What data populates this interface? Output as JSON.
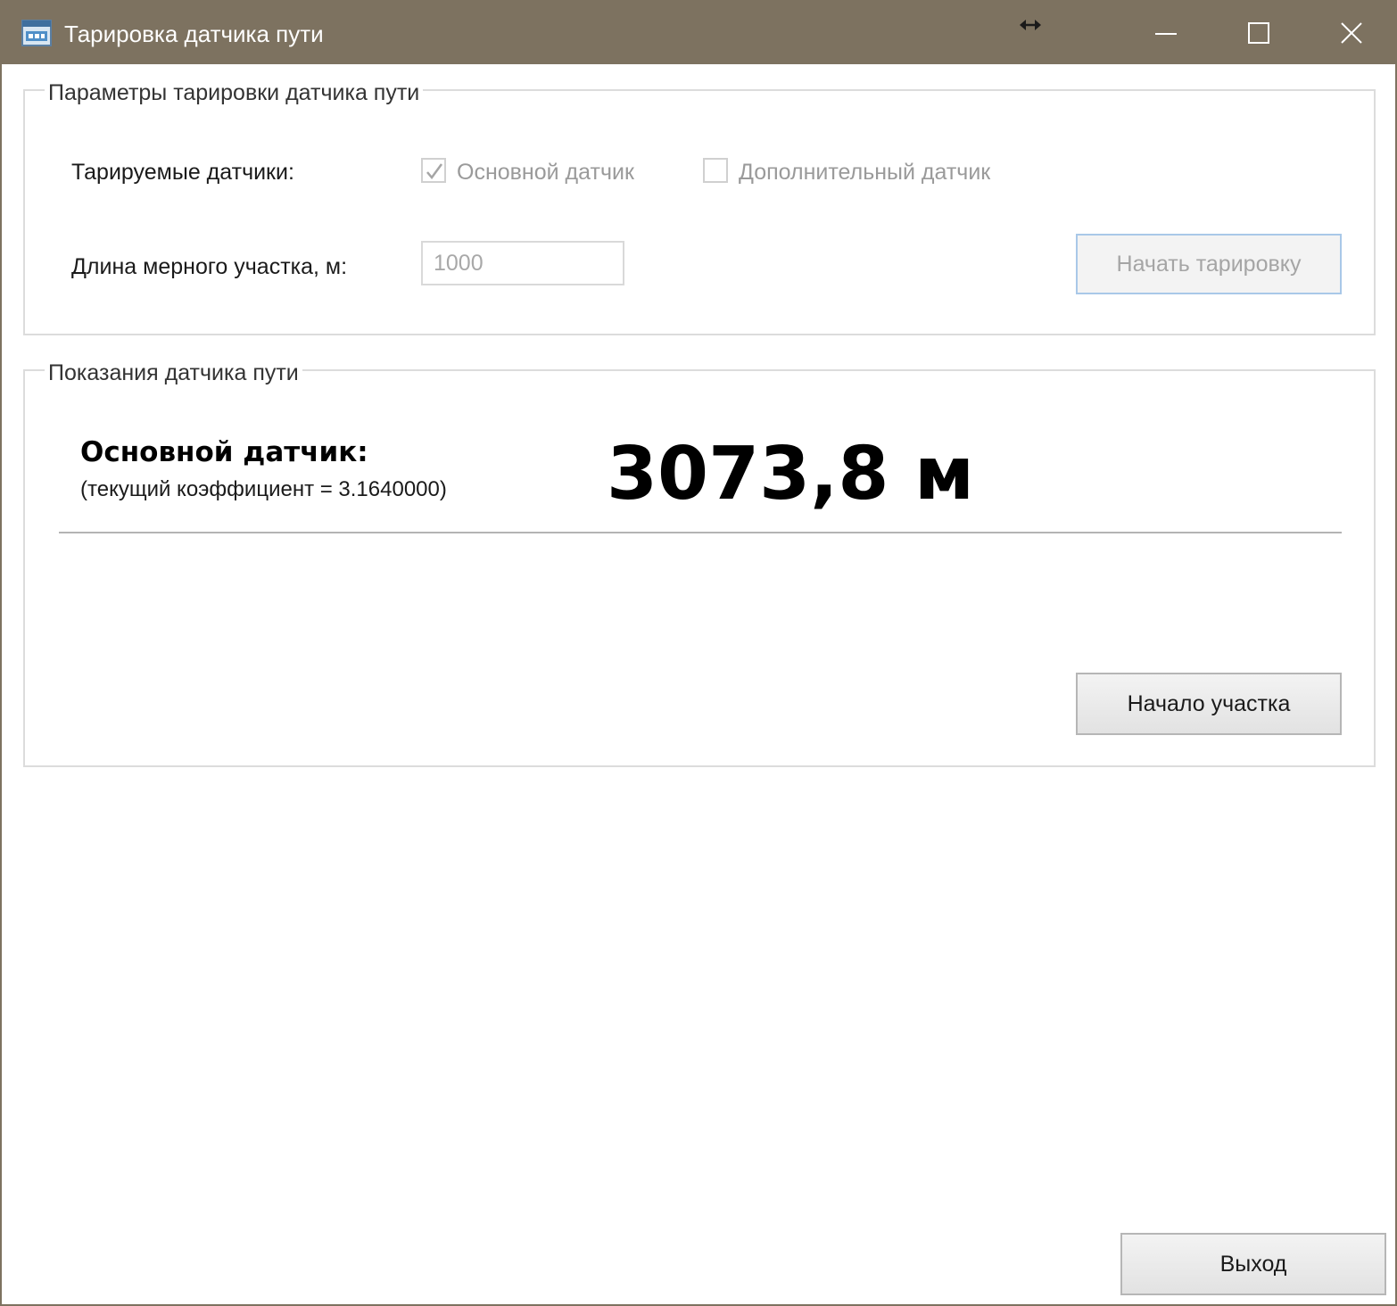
{
  "window": {
    "title": "Тарировка датчика пути"
  },
  "params_group": {
    "legend": "Параметры тарировки датчика пути",
    "sensors_label": "Тарируемые датчики:",
    "main_sensor_checkbox": {
      "label": "Основной датчик",
      "checked": true,
      "enabled": false
    },
    "extra_sensor_checkbox": {
      "label": "Дополнительный датчик",
      "checked": false,
      "enabled": false
    },
    "length_label": "Длина мерного участка, м:",
    "length_value": "1000",
    "start_button_label": "Начать тарировку"
  },
  "readings_group": {
    "legend": "Показания датчика пути",
    "sensor_title": "Основной датчик:",
    "coefficient_text": "(текущий коэффициент = 3.1640000)",
    "value_text": "3073,8 м",
    "section_start_button_label": "Начало участка"
  },
  "footer": {
    "exit_button_label": "Выход"
  },
  "icons": {
    "app": "app-window-icon",
    "resize": "resize-horizontal-icon",
    "minimize": "minimize-icon",
    "maximize": "maximize-icon",
    "close": "close-icon",
    "check": "check-icon"
  },
  "colors": {
    "titlebar": "#7d7260",
    "disabled_text": "#9a9a9a",
    "button_focus_border": "#a9c8e8"
  }
}
